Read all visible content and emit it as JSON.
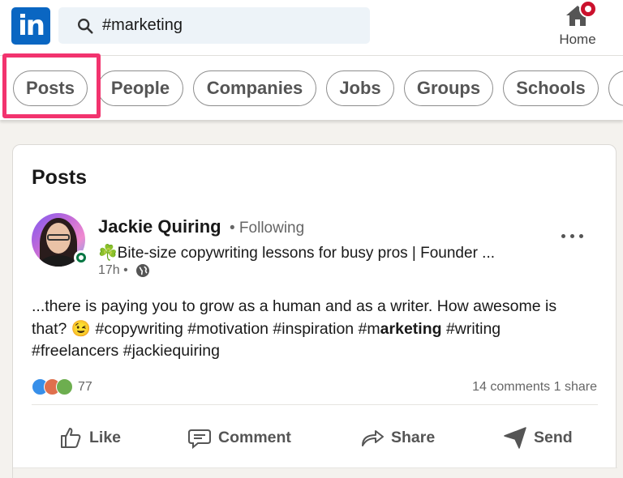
{
  "header": {
    "logo_text": "in",
    "search": {
      "value": "#marketing",
      "placeholder": "Search"
    },
    "home_label": "Home"
  },
  "filters": [
    "Posts",
    "People",
    "Companies",
    "Jobs",
    "Groups",
    "Schools"
  ],
  "highlight_color": "#f2336e",
  "card": {
    "title": "Posts",
    "post": {
      "author": "Jackie Quiring",
      "following": "• Following",
      "headline": "☘️Bite-size copywriting lessons for busy pros | Founder ...",
      "time": "17h •",
      "body_pre": "...there is paying you to grow as a human and as a writer. How awesome is that? 😉 #copywriting #motivation #inspiration #m",
      "body_bold": "arketing",
      "body_post": " #writing #freelancers #jackiequiring",
      "reaction_count": "77",
      "social_counts": "14 comments 1 share",
      "actions": [
        "Like",
        "Comment",
        "Share",
        "Send"
      ]
    }
  },
  "colors": {
    "brand": "#0a66c2",
    "online": "#057642",
    "notification": "#cb112d"
  }
}
